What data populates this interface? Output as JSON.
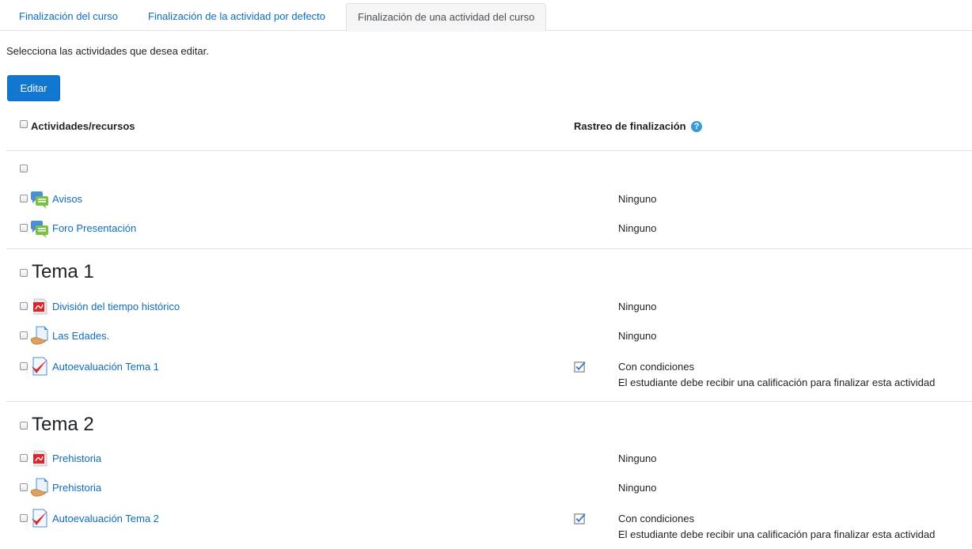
{
  "tabs": [
    {
      "label": "Finalización del curso",
      "active": false
    },
    {
      "label": "Finalización de la actividad por defecto",
      "active": false
    },
    {
      "label": "Finalización de una actividad del curso",
      "active": true
    }
  ],
  "intro": "Selecciona las actividades que desea editar.",
  "edit_button": "Editar",
  "table_header": {
    "activities": "Actividades/recursos",
    "tracking": "Rastreo de finalización",
    "help_icon": "question-circle-icon"
  },
  "sections": [
    {
      "title": "",
      "activities": [
        {
          "name": "Avisos",
          "icon": "forum-icon",
          "status": "Ninguno"
        },
        {
          "name": "Foro Presentación",
          "icon": "forum-icon",
          "status": "Ninguno"
        }
      ]
    },
    {
      "title": "Tema 1",
      "activities": [
        {
          "name": "División del tiempo histórico",
          "icon": "pdf-icon",
          "status": "Ninguno"
        },
        {
          "name": "Las Edades.",
          "icon": "page-icon",
          "status": "Ninguno"
        },
        {
          "name": "Autoevaluación Tema 1",
          "icon": "quiz-icon",
          "status": "Con condiciones",
          "condition": "El estudiante debe recibir una calificación para finalizar esta actividad"
        }
      ]
    },
    {
      "title": "Tema 2",
      "activities": [
        {
          "name": "Prehistoria",
          "icon": "pdf-icon",
          "status": "Ninguno"
        },
        {
          "name": "Prehistoria",
          "icon": "page-icon",
          "status": "Ninguno"
        },
        {
          "name": "Autoevaluación Tema 2",
          "icon": "quiz-icon",
          "status": "Con condiciones",
          "condition": "El estudiante debe recibir una calificación para finalizar esta actividad"
        }
      ]
    }
  ],
  "colors": {
    "link": "#0f6cbf",
    "button": "#1177d1",
    "help": "#3a9ad9"
  }
}
